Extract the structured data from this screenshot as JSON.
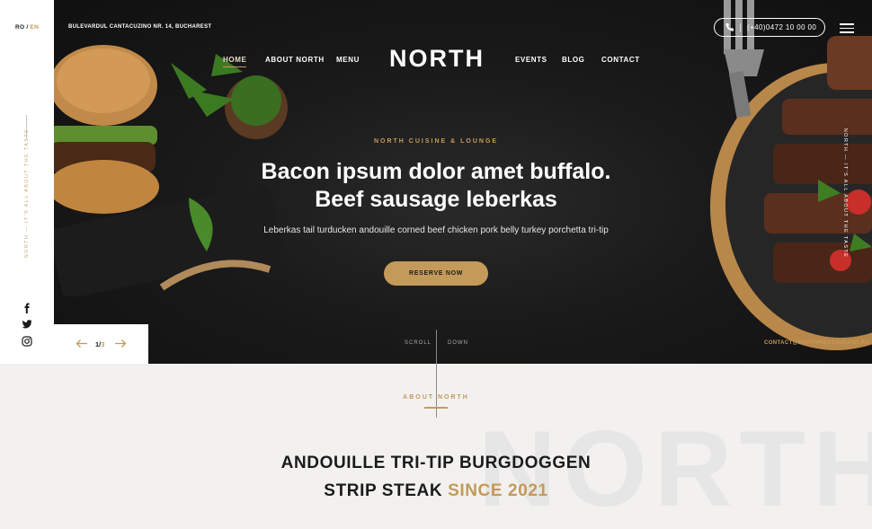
{
  "lang": {
    "ro": "RO",
    "separator": "/",
    "en": "EN",
    "active": "EN"
  },
  "address": "BULEVARDUL CANTACUZINO NR. 14, BUCHAREST",
  "nav": {
    "left": [
      "HOME",
      "ABOUT NORTH",
      "MENU"
    ],
    "right": [
      "EVENTS",
      "BLOG",
      "CONTACT"
    ],
    "active": "HOME"
  },
  "logo": "NORTH",
  "phone": "(+40)0472 10 00 00",
  "hero": {
    "kicker": "NORTH CUISINE & LOUNGE",
    "headline_line1": "Bacon ipsum dolor amet buffalo.",
    "headline_line2": "Beef sausage leberkas",
    "subline": "Leberkas tail turducken andouille corned beef chicken pork belly turkey porchetta tri-tip",
    "cta": "RESERVE NOW"
  },
  "scroll": {
    "left": "SCROLL",
    "right": "DOWN"
  },
  "contact_email": "CONTACT@NORTHRESTAURANT.RO",
  "rail_tagline": "NORTH — IT'S ALL ABOUT THE TASTE",
  "side_tagline": "NORTH — IT'S ALL ABOUT THE TASTE",
  "slider": {
    "current": "1",
    "separator": "/",
    "total": "3"
  },
  "about": {
    "kicker": "ABOUT NORTH",
    "title_line1": "ANDOUILLE TRI-TIP BURGDOGGEN",
    "title_line2_plain": "STRIP STEAK",
    "title_line2_accent": "SINCE 2021",
    "watermark": "NORTH"
  },
  "icons": [
    "facebook-icon",
    "twitter-icon",
    "instagram-icon",
    "phone-icon",
    "hamburger-menu-icon",
    "arrow-left-icon",
    "arrow-right-icon"
  ],
  "colors": {
    "accent": "#c49a5a",
    "dark": "#1b1b1b",
    "light_bg": "#f2f1ef"
  }
}
